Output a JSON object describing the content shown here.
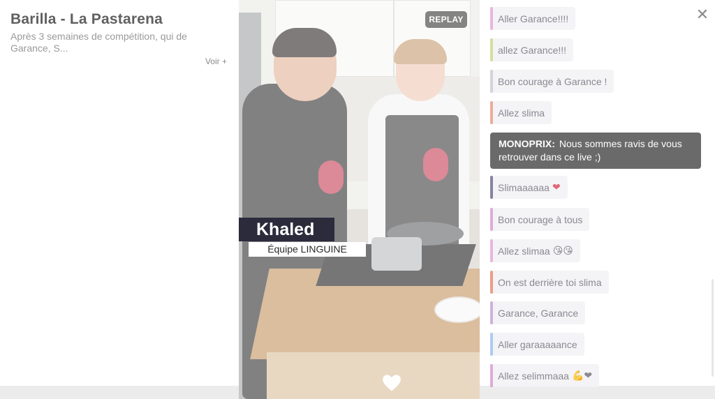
{
  "event": {
    "title": "Barilla - La Pastarena",
    "description": "Après 3 semaines de compétition, qui de Garance, S...",
    "more_label": "Voir +"
  },
  "video": {
    "status_badge": "REPLAY",
    "speaker_name": "Khaled",
    "speaker_team": "Équipe LINGUINE",
    "like_icon": "heart-icon"
  },
  "chat": {
    "close_icon": "close-icon",
    "messages": [
      {
        "text": "Aller Garance!!!!",
        "color": "#e3a6d6",
        "emoji": ""
      },
      {
        "text": "allez Garance!!!",
        "color": "#c8d88a",
        "emoji": ""
      },
      {
        "text": "Bon courage à Garance !",
        "color": "#c9cbd2",
        "emoji": ""
      },
      {
        "text": "Allez slima",
        "color": "#e89a86",
        "emoji": ""
      },
      {
        "text": "Slimaaaaaa",
        "color": "#6b6a8e",
        "emoji": "❤"
      },
      {
        "text": "Bon courage à tous",
        "color": "#d79ad1",
        "emoji": ""
      },
      {
        "text": "Allez slimaa",
        "color": "#e3a6d6",
        "emoji": "😘😘"
      },
      {
        "text": "On est derrière toi slima",
        "color": "#e8896e",
        "emoji": ""
      },
      {
        "text": "Garance, Garance",
        "color": "#c6a0d6",
        "emoji": ""
      },
      {
        "text": "Aller garaaaaance",
        "color": "#9ec0ef",
        "emoji": ""
      },
      {
        "text": "Allez selimmaaa",
        "color": "#d79ad1",
        "emoji": "💪❤"
      }
    ],
    "sponsor": {
      "name": "MONOPRIX:",
      "text": "Nous sommes ravis de vous retrouver dans ce live ;)"
    }
  }
}
